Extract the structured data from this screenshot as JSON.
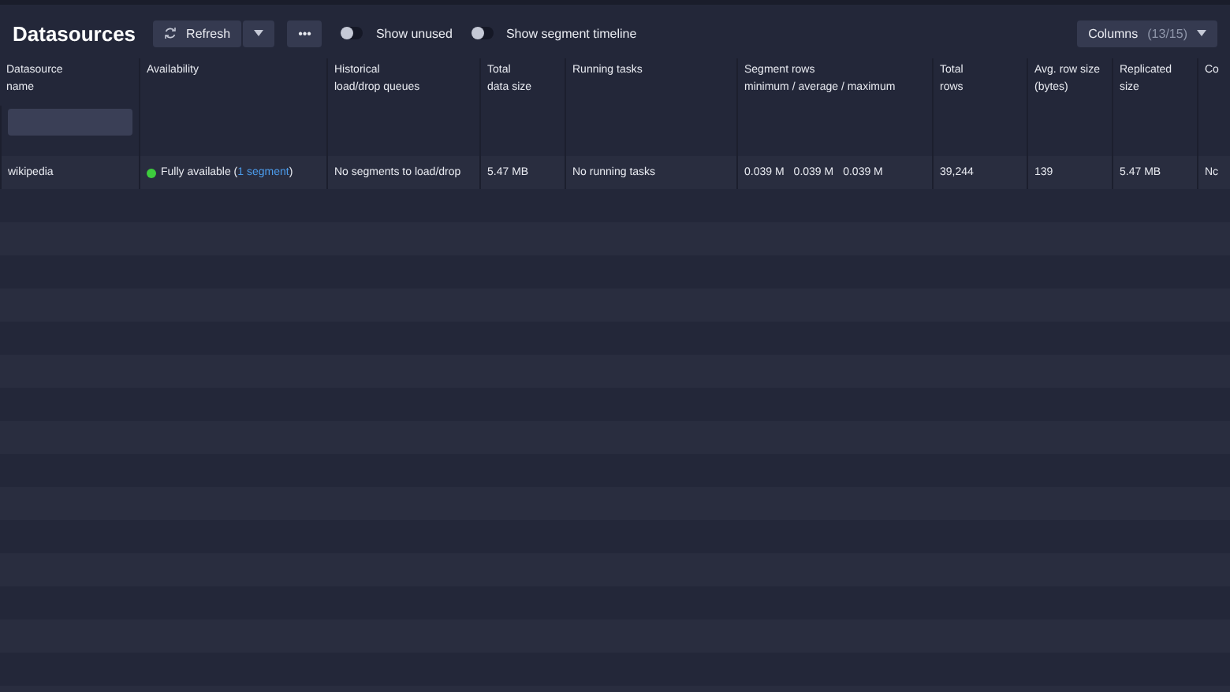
{
  "title": "Datasources",
  "toolbar": {
    "refresh": "Refresh",
    "more": "•••",
    "toggles": [
      {
        "label": "Show unused",
        "on": false
      },
      {
        "label": "Show segment timeline",
        "on": false
      }
    ],
    "columns_button": {
      "label": "Columns",
      "count": "(13/15)"
    }
  },
  "table": {
    "columns": [
      {
        "label": "Datasource\nname"
      },
      {
        "label": "Availability"
      },
      {
        "label": "Historical\nload/drop queues"
      },
      {
        "label": "Total\ndata size"
      },
      {
        "label": "Running tasks"
      },
      {
        "label": "Segment rows\nminimum / average / maximum"
      },
      {
        "label": "Total\nrows"
      },
      {
        "label": "Avg. row size\n(bytes)"
      },
      {
        "label": "Replicated\nsize"
      },
      {
        "label": "Co"
      }
    ],
    "rows": [
      {
        "name": "wikipedia",
        "availability": {
          "color": "#3dcc3d",
          "text": "Fully available (",
          "link": "1 segment",
          "after": ")"
        },
        "queues": "No segments to load/drop",
        "size": "5.47 MB",
        "tasks": "No running tasks",
        "segment_rows": [
          "0.039 M",
          "0.039 M",
          "0.039 M"
        ],
        "total_rows": "39,244",
        "avg_row": "139",
        "replicated": "5.47 MB",
        "column_10": "Nc"
      }
    ]
  }
}
